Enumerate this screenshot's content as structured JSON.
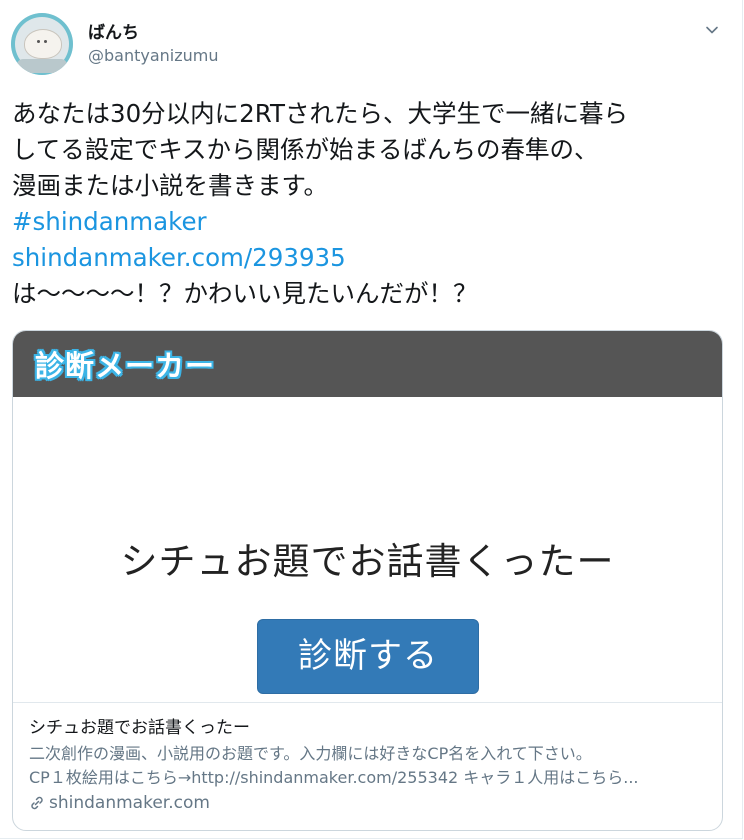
{
  "user": {
    "display_name": "ばんち",
    "handle": "@bantyanizumu",
    "avatar_icon": "mascot-avatar-icon"
  },
  "tweet": {
    "lines": [
      "あなたは30分以内に2RTされたら、大学生で一緒に暮ら",
      "してる設定でキスから関係が始まるばんちの春隼の、",
      "漫画または小説を書きます。"
    ],
    "hashtag": "#shindanmaker",
    "url": "shindanmaker.com/293935",
    "reply": " は〜〜〜〜！？かわいい見たいんだが！？"
  },
  "card": {
    "banner_title": "診断メーカー",
    "heading": "シチュお題でお話書くったー",
    "button_label": "診断する",
    "title": "シチュお題でお話書くったー",
    "description_1": "二次創作の漫画、小説用のお題です。入力欄には好きなCP名を入れて下さい。",
    "description_2": "CP１枚絵用はこちら→http://shindanmaker.com/255342 キャラ１人用はこちら...",
    "site": "shindanmaker.com"
  },
  "colors": {
    "link": "#1b95e0",
    "banner_bg": "#555555",
    "banner_outline": "#3cb4e6",
    "button": "#337ab7"
  }
}
